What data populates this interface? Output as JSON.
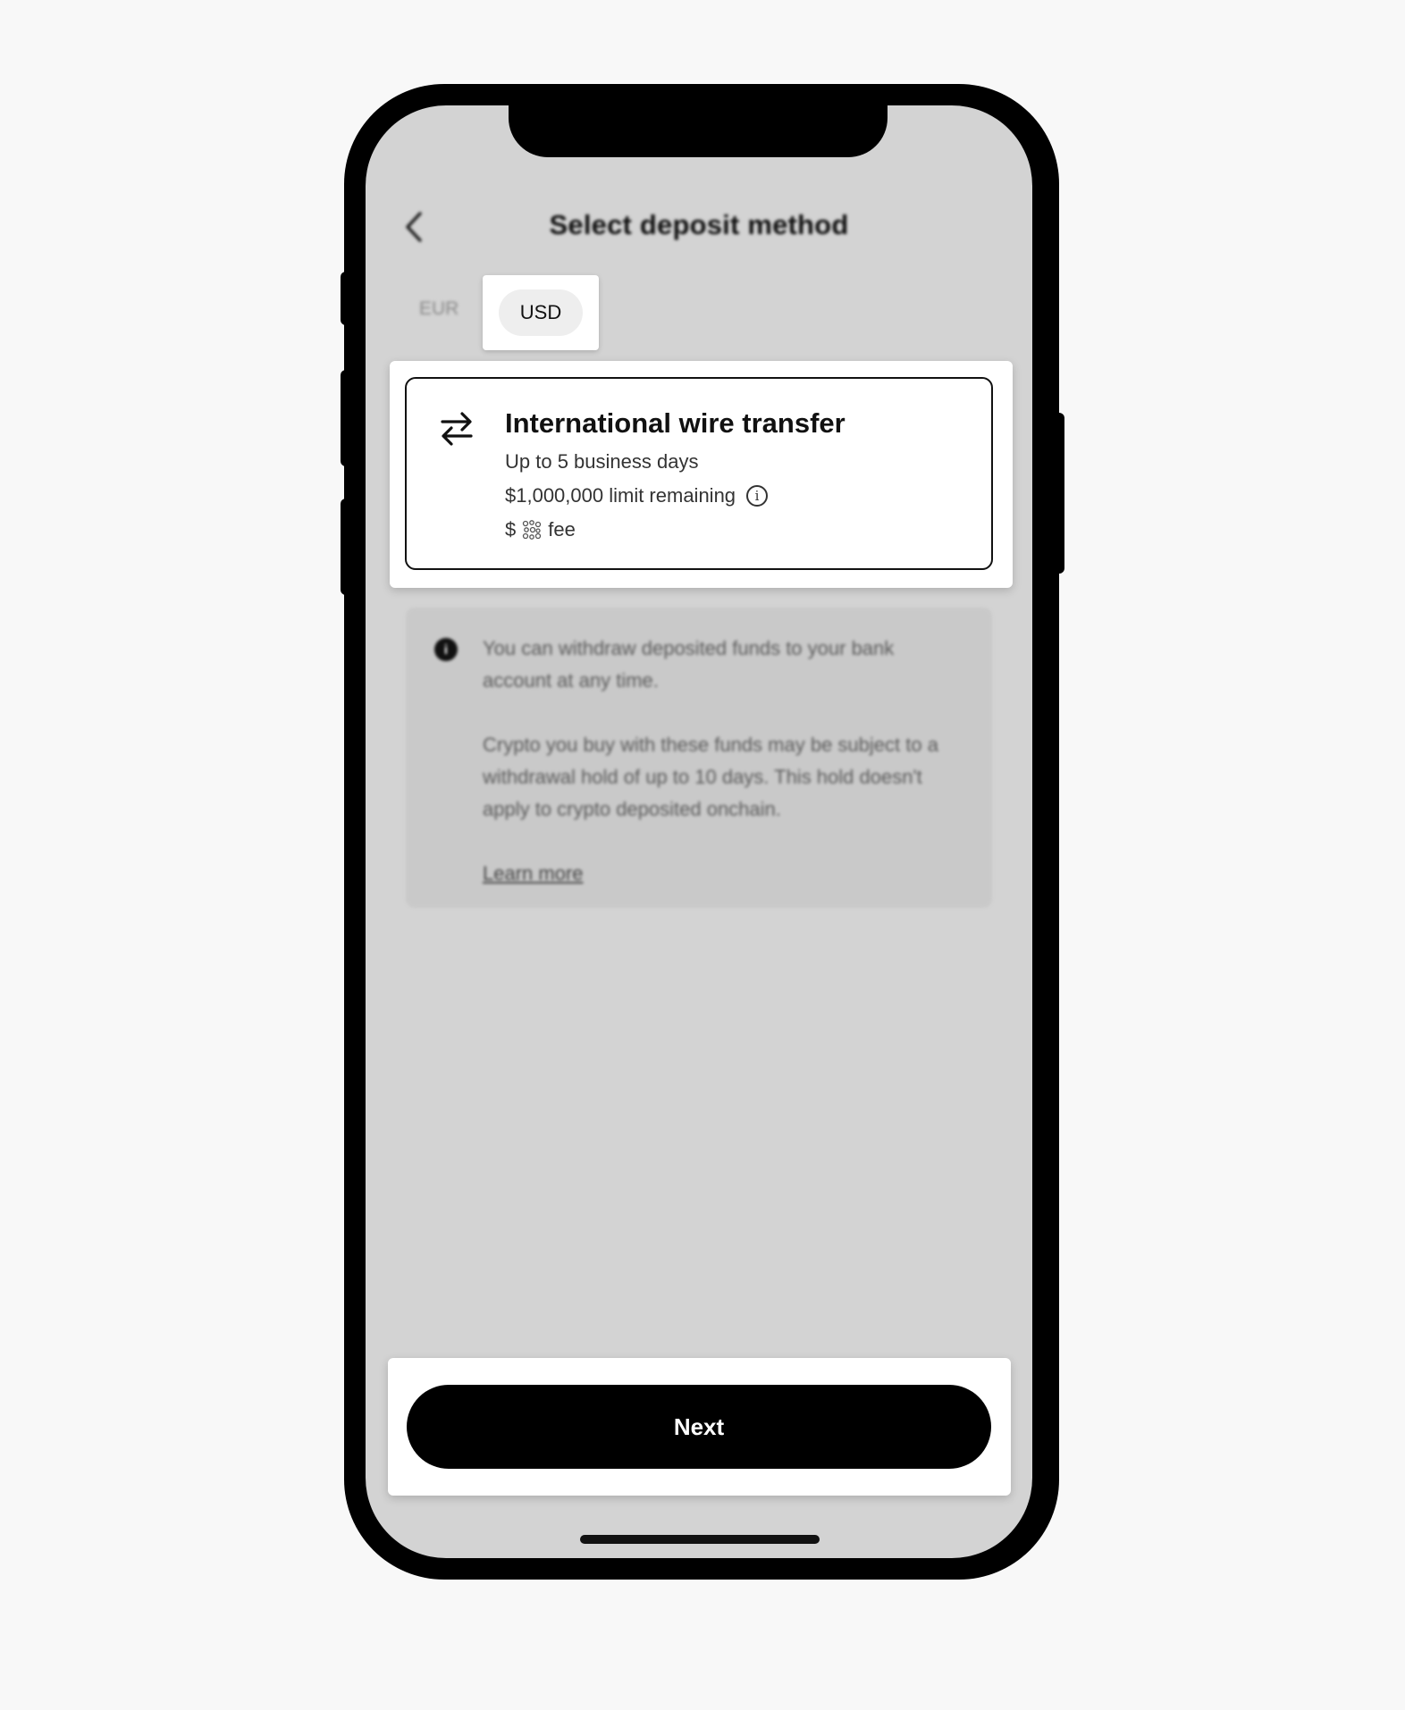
{
  "header": {
    "title": "Select deposit method"
  },
  "currency_tabs": [
    {
      "label": "EUR",
      "selected": false
    },
    {
      "label": "USD",
      "selected": true
    }
  ],
  "method": {
    "icon": "transfer-arrows-icon",
    "title": "International wire transfer",
    "duration": "Up to 5 business days",
    "limit": "$1,000,000 limit remaining",
    "fee_prefix": "$",
    "fee_suffix": "fee"
  },
  "info": {
    "icon": "info-icon",
    "paragraph_1": "You can withdraw deposited funds to your bank account at any time.",
    "paragraph_2": "Crypto you buy with these funds may be subject to a withdrawal hold of up to 10 days. This hold doesn't apply to crypto deposited onchain.",
    "link": "Learn more"
  },
  "footer": {
    "next_label": "Next"
  },
  "colors": {
    "screen_bg": "#d3d3d3",
    "primary": "#000000",
    "surface": "#ffffff"
  }
}
